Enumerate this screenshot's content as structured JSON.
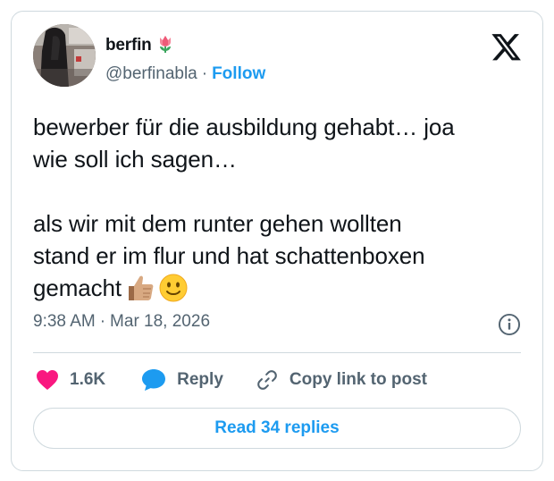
{
  "author": {
    "name": "berfin",
    "name_emoji": "tulip-emoji",
    "handle": "@berfinabla",
    "separator": "·",
    "follow_label": "Follow"
  },
  "tweet": {
    "lines": [
      "bewerber für die ausbildung gehabt… joa",
      "wie soll ich sagen…",
      "als wir mit dem runter gehen wollten",
      "stand er im flur und hat schattenboxen",
      "gemacht"
    ],
    "trailing_emojis": [
      "thumbs-up-emoji",
      "slightly-smiling-face-emoji"
    ],
    "time": "9:38 AM",
    "separator": "·",
    "date": "Mar 18, 2026"
  },
  "actions": {
    "likes": "1.6K",
    "reply_label": "Reply",
    "copy_label": "Copy link to post"
  },
  "read_replies_label": "Read 34 replies",
  "colors": {
    "accent": "#1d9bf0",
    "like": "#f91880",
    "text": "#0f1419",
    "secondary": "#536471",
    "border": "#cfd9de"
  },
  "icons": [
    "x-logo-icon",
    "info-icon",
    "heart-icon",
    "reply-bubble-icon",
    "link-icon"
  ]
}
